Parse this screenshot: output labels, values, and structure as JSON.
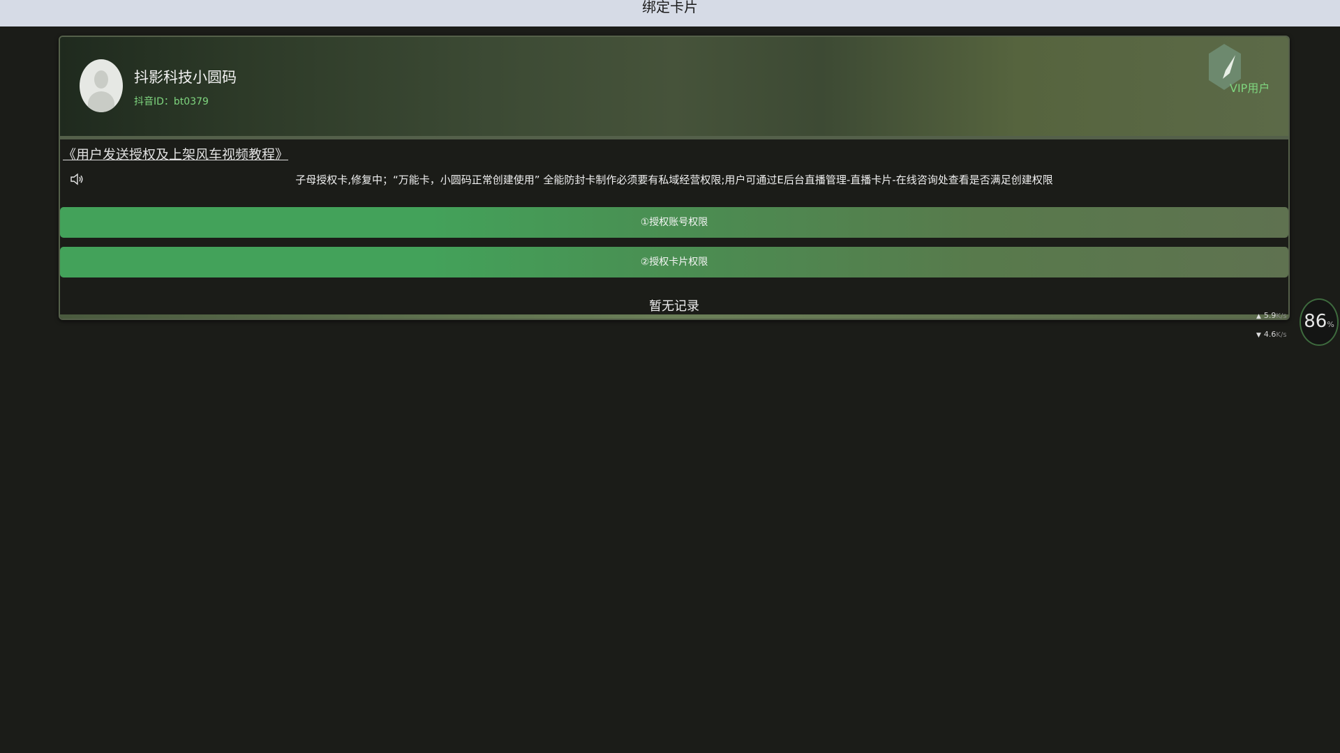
{
  "window": {
    "title": "绑定卡片"
  },
  "profile": {
    "name": "抖影科技小圆码",
    "id_text": "抖音ID：bt0379",
    "badge": "VIP用户"
  },
  "tutorial": {
    "link_text": "《用户发送授权及上架风车视频教程》"
  },
  "notice": {
    "text": "子母授权卡,修复中；“万能卡，小圆码正常创建使用” 全能防封卡制作必须要有私域经营权限;用户可通过E后台直播管理-直播卡片-在线咨询处查看是否满足创建权限",
    "icon": "speaker-icon"
  },
  "actions": [
    {
      "label": "①授权账号权限"
    },
    {
      "label": "②授权卡片权限"
    }
  ],
  "records": {
    "empty_text": "暂无记录"
  },
  "network": {
    "upload": "5.9",
    "download": "4.6",
    "unit": "K/s",
    "percent": "86",
    "percent_sign": "%"
  },
  "colors": {
    "button_green": "#43a25a",
    "id_green": "#7fd67f",
    "background": "#1b1c18",
    "top_bar": "#d6dbe6"
  }
}
